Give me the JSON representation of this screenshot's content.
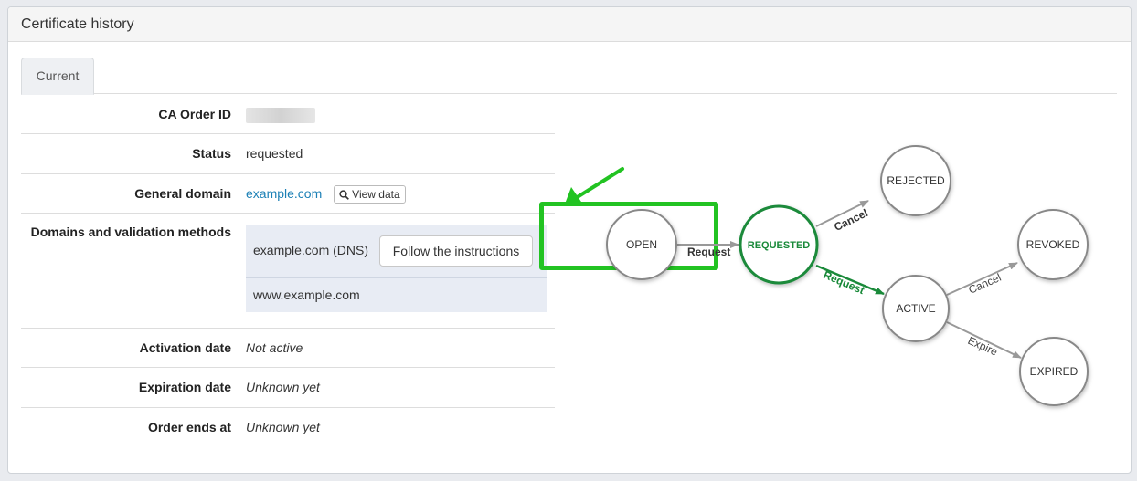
{
  "panel": {
    "title": "Certificate history"
  },
  "tabs": [
    {
      "label": "Current"
    }
  ],
  "details": {
    "ca_order_id_label": "CA Order ID",
    "status_label": "Status",
    "status_value": "requested",
    "general_domain_label": "General domain",
    "general_domain_value": "example.com",
    "view_data_label": "View data",
    "domains_label": "Domains and validation methods",
    "domains": [
      {
        "name": "example.com (DNS)",
        "action": "Follow the instructions"
      },
      {
        "name": "www.example.com"
      }
    ],
    "activation_label": "Activation date",
    "activation_value": "Not active",
    "expiration_label": "Expiration date",
    "expiration_value": "Unknown yet",
    "order_ends_label": "Order ends at",
    "order_ends_value": "Unknown yet"
  },
  "state_diagram": {
    "states": [
      "OPEN",
      "REQUESTED",
      "REJECTED",
      "ACTIVE",
      "REVOKED",
      "EXPIRED"
    ],
    "current_state": "REQUESTED",
    "transitions": [
      {
        "from": "OPEN",
        "to": "REQUESTED",
        "label": "Request"
      },
      {
        "from": "REQUESTED",
        "to": "REJECTED",
        "label": "Cancel"
      },
      {
        "from": "REQUESTED",
        "to": "ACTIVE",
        "label": "Request"
      },
      {
        "from": "ACTIVE",
        "to": "REVOKED",
        "label": "Cancel"
      },
      {
        "from": "ACTIVE",
        "to": "EXPIRED",
        "label": "Expire"
      }
    ]
  },
  "colors": {
    "current_state": "#1a8a3a",
    "highlight": "#22c322",
    "link": "#1a7fb5"
  }
}
